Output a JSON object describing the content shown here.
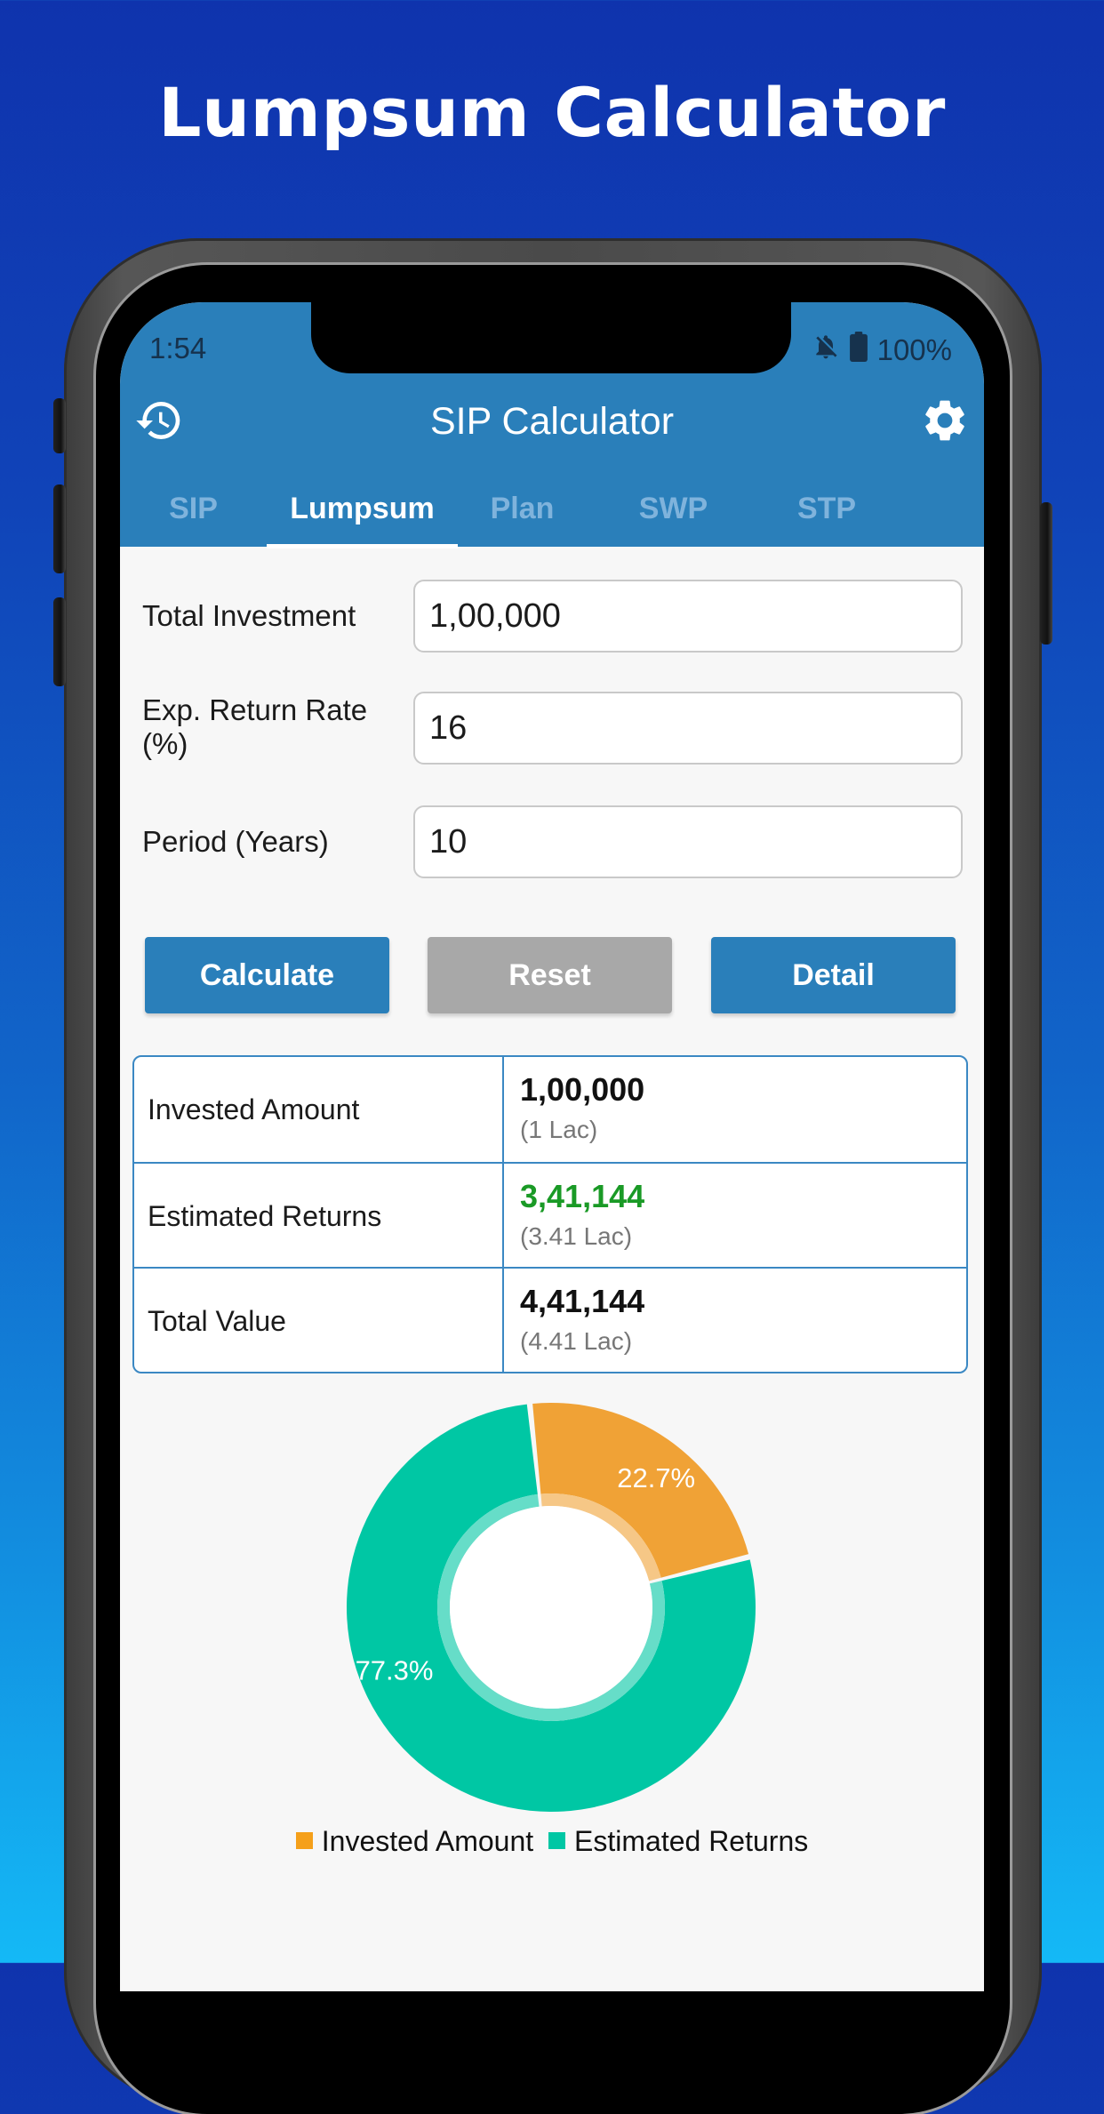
{
  "promo": {
    "title": "Lumpsum Calculator"
  },
  "status_bar": {
    "time": "1:54",
    "battery": "100%",
    "icons": [
      "bell-off-icon",
      "battery-icon"
    ]
  },
  "toolbar": {
    "title": "SIP Calculator",
    "left_icon": "history-icon",
    "right_icon": "settings-gear-icon"
  },
  "tabs": [
    {
      "label": "SIP",
      "active": false
    },
    {
      "label": "Lumpsum",
      "active": true
    },
    {
      "label": "Plan",
      "active": false
    },
    {
      "label": "SWP",
      "active": false
    },
    {
      "label": "STP",
      "active": false
    }
  ],
  "form": {
    "fields": [
      {
        "label": "Total Investment",
        "value": "1,00,000"
      },
      {
        "label_line1": "Exp. Return Rate",
        "label_line2": "(%)",
        "value": "16"
      },
      {
        "label": "Period (Years)",
        "value": "10"
      }
    ]
  },
  "buttons": {
    "calculate": "Calculate",
    "reset": "Reset",
    "detail": "Detail"
  },
  "results": [
    {
      "label": "Invested Amount",
      "value": "1,00,000",
      "sub": "(1 Lac)"
    },
    {
      "label": "Estimated Returns",
      "value": "3,41,144",
      "sub": "(3.41 Lac)"
    },
    {
      "label": "Total Value",
      "value": "4,41,144",
      "sub": "(4.41 Lac)"
    }
  ],
  "colors": {
    "primary": "#2a7fba",
    "reset": "#a8a8a8",
    "invested": "#f0a236",
    "returns": "#00c7a4",
    "returns_text": "#1a9a26"
  },
  "chart_data": {
    "type": "pie",
    "variant": "donut",
    "title": "",
    "categories": [
      "Invested Amount",
      "Estimated Returns"
    ],
    "values": [
      22.7,
      77.3
    ],
    "labels": [
      "22.7%",
      "77.3%"
    ],
    "colors": [
      "#f0a236",
      "#00c7a4"
    ],
    "legend": {
      "position": "bottom",
      "entries": [
        "Invested Amount",
        "Estimated Returns"
      ]
    }
  }
}
